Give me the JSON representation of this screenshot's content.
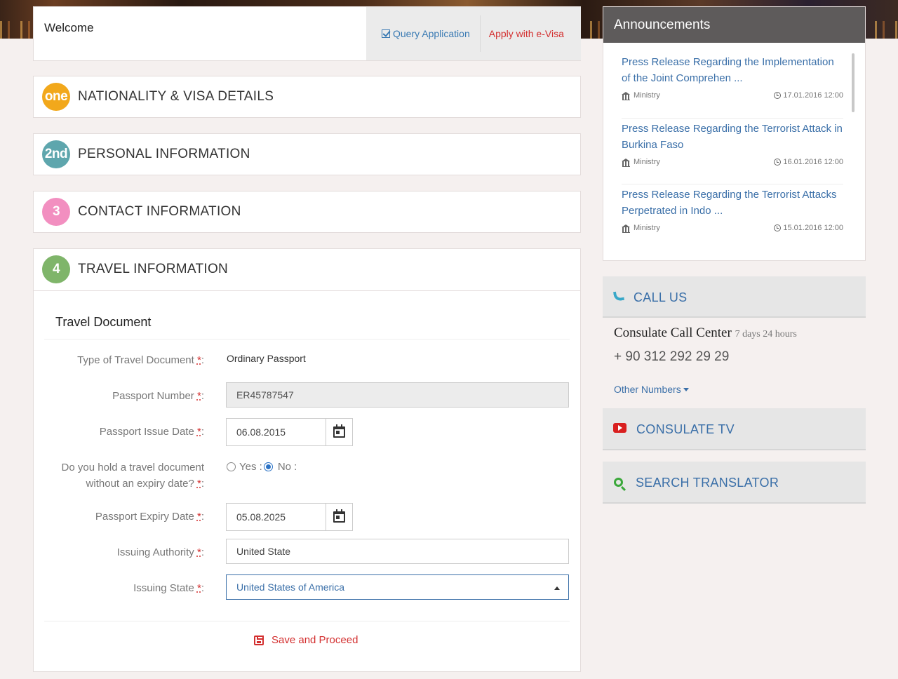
{
  "header": {
    "welcome": "Welcome",
    "query_application": "Query Application",
    "apply_evisa": "Apply with e-Visa"
  },
  "steps": [
    {
      "badge": "one",
      "title": "NATIONALITY & VISA DETAILS",
      "color": "#f2a81b"
    },
    {
      "badge": "2nd",
      "title": "PERSONAL INFORMATION",
      "color": "#5ea6ad"
    },
    {
      "badge": "3",
      "title": "CONTACT INFORMATION",
      "color": "#f28fc0"
    },
    {
      "badge": "4",
      "title": "TRAVEL INFORMATION",
      "color": "#7fb56a"
    }
  ],
  "travel": {
    "section_title": "Travel Document",
    "required_mark": "*",
    "fields": {
      "doc_type": {
        "label": "Type of Travel Document ",
        "value": "Ordinary Passport"
      },
      "passport_number": {
        "label": "Passport Number ",
        "value": "ER45787547"
      },
      "issue_date": {
        "label": "Passport Issue Date ",
        "value": "06.08.2015"
      },
      "no_expiry": {
        "label_line1": "Do you hold a travel document",
        "label_line2": "without an expiry date? ",
        "yes": "Yes :",
        "no": "No :",
        "selected": "No"
      },
      "expiry_date": {
        "label": "Passport Expiry Date ",
        "value": "05.08.2025"
      },
      "issuing_authority": {
        "label": "Issuing Authority ",
        "value": "United State"
      },
      "issuing_state": {
        "label": "Issuing State ",
        "value": "United States of America"
      }
    },
    "save_label": "Save and Proceed"
  },
  "announcements": {
    "title": "Announcements",
    "items": [
      {
        "title": "Press Release Regarding the Implementation of the Joint Comprehen ...",
        "source": "Ministry",
        "date": "17.01.2016 12:00"
      },
      {
        "title": "Press Release Regarding the Terrorist Attack in Burkina Faso",
        "source": "Ministry",
        "date": "16.01.2016 12:00"
      },
      {
        "title": "Press Release Regarding the Terrorist Attacks Perpetrated in Indo ...",
        "source": "Ministry",
        "date": "15.01.2016 12:00"
      }
    ]
  },
  "call_us": {
    "title": "CALL US",
    "center": "Consulate Call Center",
    "hours": "7 days 24 hours",
    "phone": "+ 90 312 292 29 29",
    "other_numbers": "Other Numbers"
  },
  "consulate_tv": {
    "title": "CONSULATE TV"
  },
  "search_translator": {
    "title": "SEARCH TRANSLATOR"
  },
  "colors": {
    "link": "#3a6fa8",
    "accent_red": "#d32f2f",
    "announce_header": "#5e5b5b"
  }
}
